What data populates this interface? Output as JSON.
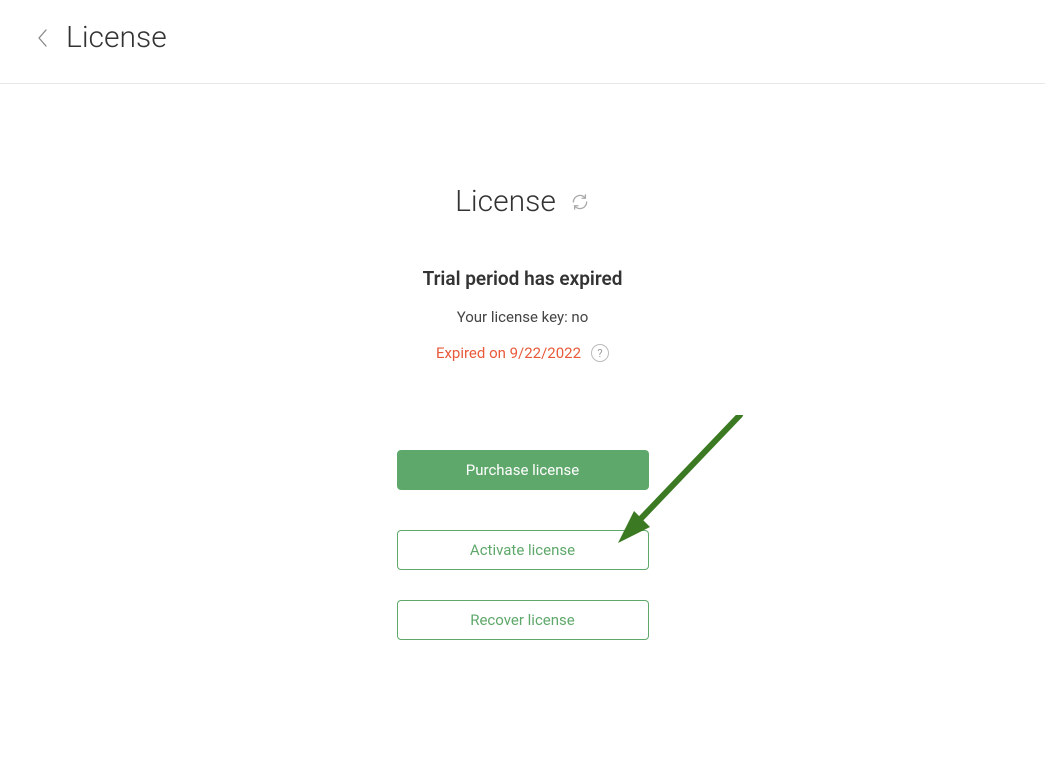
{
  "header": {
    "title": "License"
  },
  "page": {
    "title": "License",
    "status_heading": "Trial period has expired",
    "key_info": "Your license key: no",
    "expired_text": "Expired on 9/22/2022",
    "help_glyph": "?"
  },
  "buttons": {
    "purchase_label": "Purchase license",
    "activate_label": "Activate license",
    "recover_label": "Recover license"
  }
}
